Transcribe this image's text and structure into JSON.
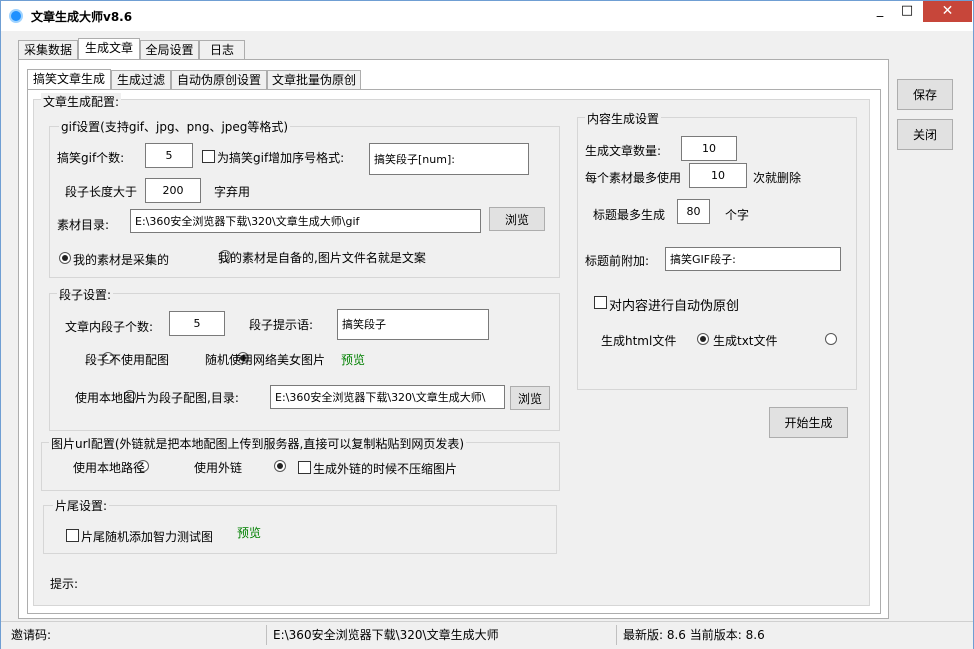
{
  "window": {
    "title": "文章生成大师v8.6",
    "minimize": "_",
    "maximize": "□",
    "close": "✕"
  },
  "main_tabs": [
    "采集数据",
    "生成文章",
    "全局设置",
    "日志"
  ],
  "sub_tabs": [
    "搞笑文章生成",
    "生成过滤",
    "自动伪原创设置",
    "文章批量伪原创"
  ],
  "config_title": "文章生成配置:",
  "gif": {
    "title": "gif设置(支持gif、jpg、png、jpeg等格式)",
    "count_label": "搞笑gif个数:",
    "count_value": "5",
    "seq_checkbox_label": "为搞笑gif增加序号格式:",
    "seq_format_value": "搞笑段子[num]:",
    "length_label": "段子长度大于",
    "length_value": "200",
    "length_suffix": "字弃用",
    "dir_label": "素材目录:",
    "dir_value": "E:\\360安全浏览器下载\\320\\文章生成大师\\gif",
    "browse": "浏览",
    "radio_collected": "我的素材是采集的",
    "radio_own": "我的素材是自备的,图片文件名就是文案"
  },
  "joke": {
    "title": "段子设置:",
    "count_label": "文章内段子个数:",
    "count_value": "5",
    "hint_label": "段子提示语:",
    "hint_value": "搞笑段子",
    "radio_no_image": "段子不使用配图",
    "radio_web_image": "随机使用网络美女图片",
    "preview": "预览",
    "radio_local": "使用本地图片为段子配图,目录:",
    "local_dir_value": "E:\\360安全浏览器下载\\320\\文章生成大师\\",
    "browse": "浏览"
  },
  "url": {
    "title": "图片url配置(外链就是把本地配图上传到服务器,直接可以复制粘贴到网页发表)",
    "radio_local": "使用本地路径",
    "radio_external": "使用外链",
    "no_compress": "生成外链的时候不压缩图片"
  },
  "tail": {
    "title": "片尾设置:",
    "checkbox": "片尾随机添加智力测试图",
    "preview": "预览"
  },
  "tip_label": "提示:",
  "content": {
    "title": "内容生成设置",
    "count_label": "生成文章数量:",
    "count_value": "10",
    "max_use_label": "每个素材最多使用",
    "max_use_value": "10",
    "max_use_suffix": "次就删除",
    "title_max_label": "标题最多生成",
    "title_max_value": "80",
    "title_max_suffix": "个字",
    "prefix_label": "标题前附加:",
    "prefix_value": "搞笑GIF段子:",
    "auto_rewrite": "对内容进行自动伪原创",
    "gen_html": "生成html文件",
    "gen_txt": "生成txt文件"
  },
  "start_button": "开始生成",
  "save_button": "保存",
  "close_button": "关闭",
  "status": {
    "invite": "邀请码:",
    "path": "E:\\360安全浏览器下载\\320\\文章生成大师",
    "version": "最新版: 8.6 当前版本: 8.6"
  }
}
